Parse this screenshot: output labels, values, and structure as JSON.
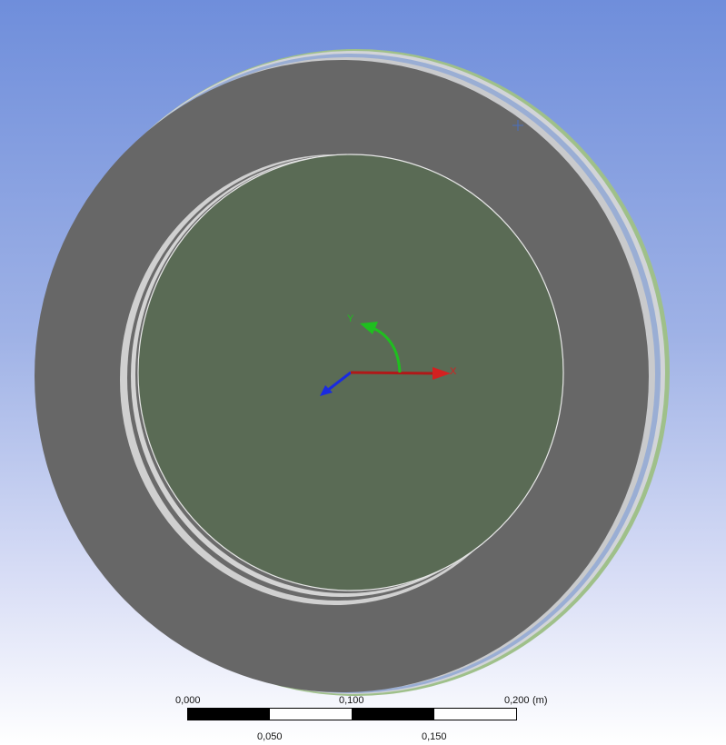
{
  "viewport": {
    "background_top": "#6f8edb",
    "background_bottom": "#ffffff"
  },
  "model": {
    "outer_ring_color": "#676767",
    "inner_face_color": "#5a6b55",
    "edge_highlight_color": "#c7c7c7",
    "edge_green_color": "#9fc08a"
  },
  "triad": {
    "x_label": "X",
    "y_label": "Y",
    "x_color": "#d42020",
    "y_color": "#1fbf1f",
    "z_color": "#1a2be0"
  },
  "scale_bar": {
    "labels_top": [
      "0,000",
      "0,100",
      "0,200"
    ],
    "labels_bottom": [
      "0,050",
      "0,150"
    ],
    "unit": "(m)"
  }
}
